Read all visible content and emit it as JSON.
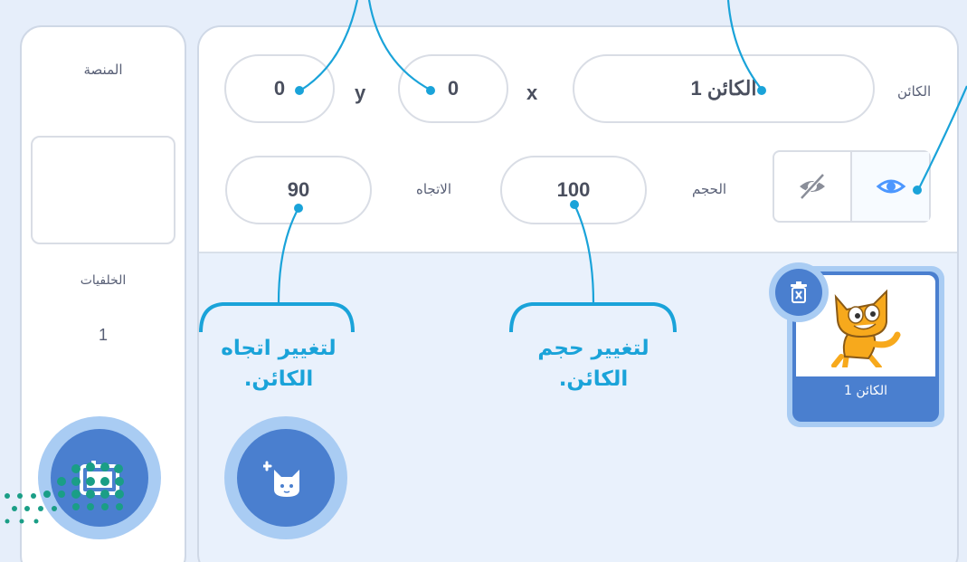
{
  "sprite_info": {
    "sprite_label": "الكائن",
    "sprite_name": "الكائن 1",
    "x_label": "x",
    "x_value": "0",
    "y_label": "y",
    "y_value": "0",
    "size_label": "الحجم",
    "size_value": "100",
    "direction_label": "الاتجاه",
    "direction_value": "90"
  },
  "stage": {
    "title": "المنصة",
    "backdrops_label": "الخلفيات",
    "backdrops_count": "1"
  },
  "sprite_list": [
    {
      "name": "الكائن 1",
      "selected": true
    }
  ],
  "callouts": {
    "size": "لتغيير حجم الكائن.",
    "direction": "لتغيير اتجاه الكائن."
  },
  "icons": {
    "show": "eye-icon",
    "hide": "eye-slash-icon",
    "delete": "trash-icon",
    "add_sprite": "cat-plus-icon",
    "add_backdrop": "backdrop-icon",
    "sprite_thumbnail": "scratch-cat-icon"
  },
  "colors": {
    "accent": "#1aa3d9",
    "scratch_blue": "#4c97ff",
    "button_blue": "#4a7fcf",
    "panel_bg": "#e9f1fc",
    "teal_dots": "#1a9e86"
  }
}
